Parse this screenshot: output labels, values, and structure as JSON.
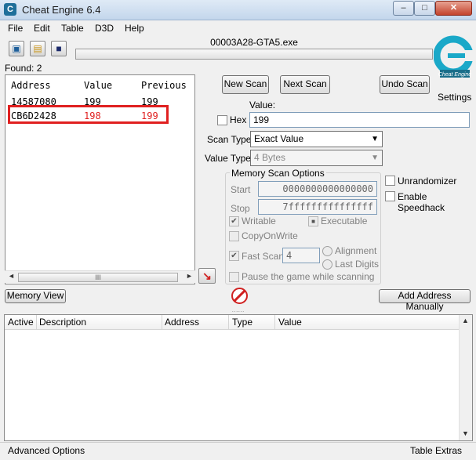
{
  "window": {
    "title": "Cheat Engine 6.4",
    "app_icon": "cheat-engine-icon",
    "min_glyph": "–",
    "max_glyph": "□",
    "close_glyph": "✕"
  },
  "menu": [
    "File",
    "Edit",
    "Table",
    "D3D",
    "Help"
  ],
  "toolbar": {
    "open_process_icon": "computer-icon",
    "open_file_icon": "folder-icon",
    "save_icon": "floppy-disk-icon",
    "open_process_glyph": "▣",
    "open_file_glyph": "▤",
    "save_glyph": "■"
  },
  "process_name": "00003A28-GTA5.exe",
  "settings_label": "Settings",
  "found_label": "Found: 2",
  "results": {
    "columns": [
      "Address",
      "Value",
      "Previous"
    ],
    "rows": [
      {
        "address": "14587080",
        "value": "199",
        "previous": "199",
        "highlighted": false
      },
      {
        "address": "CB6D2428",
        "value": "198",
        "previous": "199",
        "highlighted": true
      }
    ],
    "changed_color": "#e02020",
    "highlight_box_color": "#e02020",
    "scroll_left": "◄",
    "scroll_right": "►",
    "scroll_grip": "III"
  },
  "buttons": {
    "new_scan": "New Scan",
    "next_scan": "Next Scan",
    "undo_scan": "Undo Scan",
    "memory_view": "Memory View",
    "add_address_manually": "Add Address Manually"
  },
  "scan": {
    "value_label": "Value:",
    "hex_label": "Hex",
    "hex_checked": false,
    "value": "199",
    "scan_type_label": "Scan Type",
    "scan_type": "Exact Value",
    "value_type_label": "Value Type",
    "value_type": "4 Bytes",
    "dropdown_glyph": "▼"
  },
  "memory_options": {
    "title": "Memory Scan Options",
    "start_label": "Start",
    "start_value": "0000000000000000",
    "stop_label": "Stop",
    "stop_value": "7fffffffffffffff",
    "writable_label": "Writable",
    "writable_checked": true,
    "executable_label": "Executable",
    "executable_state": "indeterminate",
    "copy_on_write_label": "CopyOnWrite",
    "copy_on_write_checked": false,
    "fast_scan_label": "Fast Scan",
    "fast_scan_checked": true,
    "fast_scan_value": "4",
    "alignment_label": "Alignment",
    "last_digits_label": "Last Digits",
    "pause_label": "Pause the game while scanning",
    "pause_checked": false,
    "check_glyph": "✔",
    "indeterminate_glyph": "■"
  },
  "right_options": {
    "unrandomizer_label": "Unrandomizer",
    "speedhack_label": "Enable Speedhack"
  },
  "addresslist": {
    "columns": [
      "Active",
      "Description",
      "Address",
      "Type",
      "Value"
    ],
    "scroll_up": "▲",
    "scroll_down": "▼"
  },
  "splitter_grip": "······",
  "icons": {
    "add_to_list": "red-arrow-icon",
    "add_to_list_glyph": "↘",
    "stop": "stop-sign-icon"
  },
  "status": {
    "advanced_options": "Advanced Options",
    "table_extras": "Table Extras"
  }
}
